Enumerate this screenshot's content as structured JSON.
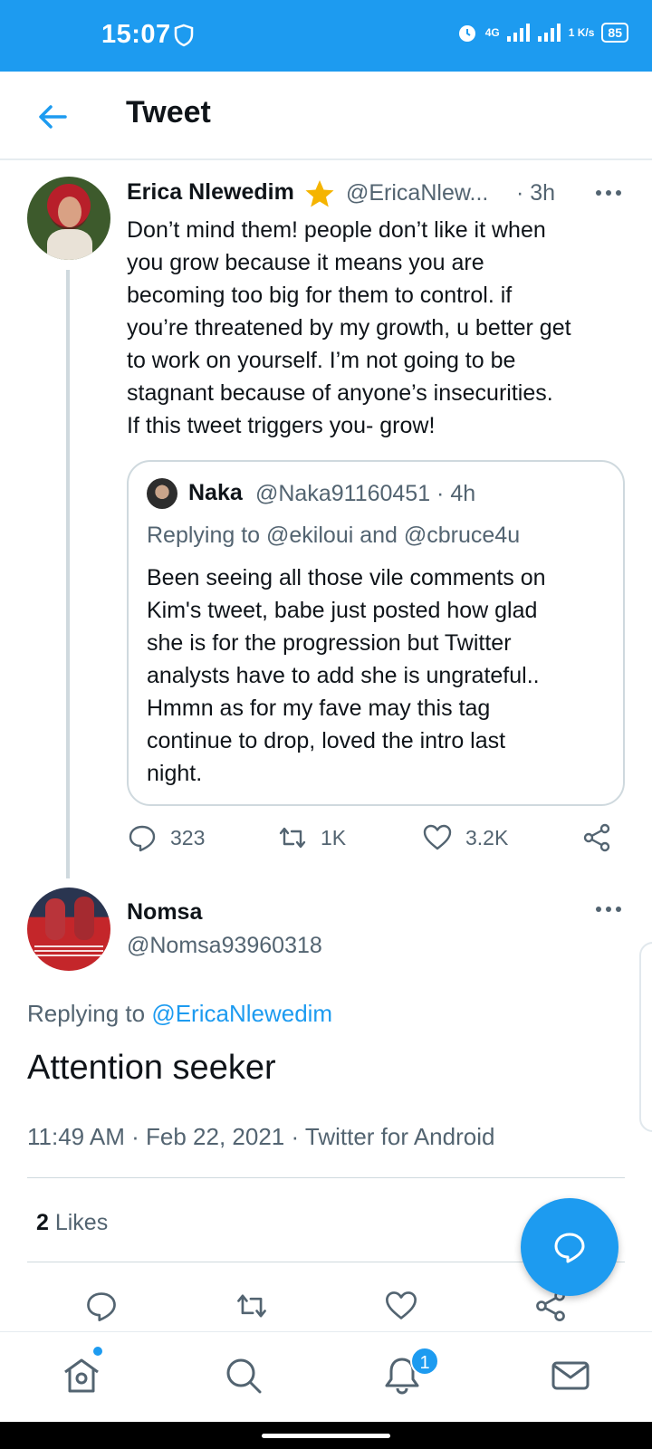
{
  "status_bar": {
    "time": "15:07",
    "network": "4G",
    "speed": "1 K/s",
    "battery": "85"
  },
  "header": {
    "title": "Tweet"
  },
  "parent_tweet": {
    "name": "Erica Nlewedim",
    "handle": "@EricaNlew...",
    "time": "· 3h",
    "text": "Don’t mind them! people don’t like it when\nyou grow because it means you are\nbecoming too big for them to control. if\nyou’re threatened by my growth, u better get\nto work on yourself. I’m not going to be\nstagnant because of anyone’s insecurities.\nIf this tweet triggers you- grow!",
    "quoted": {
      "name": "Naka",
      "handle": "@Naka91160451 · 4h",
      "replying": "Replying to @ekiloui and @cbruce4u",
      "text": "Been seeing all those vile comments on\nKim's tweet, babe just posted how glad\nshe is for the progression but Twitter\nanalysts have to add she is ungrateful..\nHmmn as for my fave may this tag\ncontinue to drop, loved the intro last\nnight."
    },
    "stats": {
      "replies": "323",
      "retweets": "1K",
      "likes": "3.2K"
    }
  },
  "focus_tweet": {
    "name": "Nomsa",
    "handle": "@Nomsa93960318",
    "replying_prefix": "Replying to ",
    "replying_to": "@EricaNlewedim",
    "text": "Attention seeker",
    "meta": "11:49 AM · Feb 22, 2021 · Twitter for Android",
    "likes_count": "2",
    "likes_label": " Likes"
  },
  "bottom_nav": {
    "notifications_badge": "1"
  },
  "colors": {
    "accent": "#1d9bf0",
    "secondary_text": "#536471",
    "star": "#f5b400"
  }
}
